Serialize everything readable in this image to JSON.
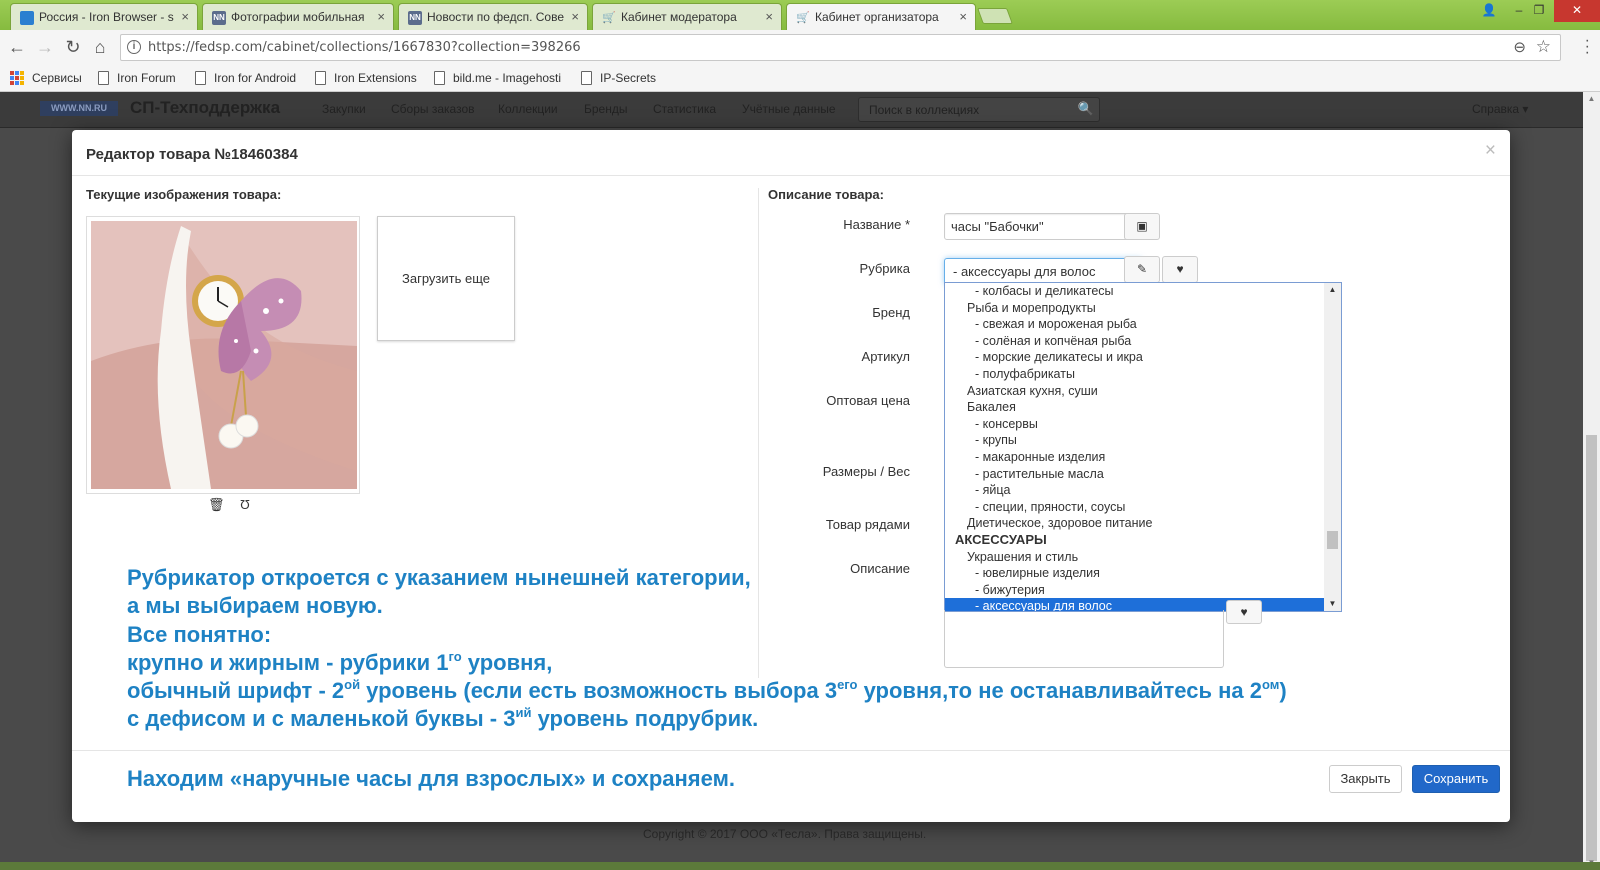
{
  "browser": {
    "tabs": [
      {
        "label": "Россия - Iron Browser - s",
        "icon": "page-blue-icon",
        "color": "#2a7fd0"
      },
      {
        "label": "Фотографии мобильная",
        "icon": "nn-icon",
        "color": "#5b6c8c"
      },
      {
        "label": "Новости по федсп. Сове",
        "icon": "nn-icon",
        "color": "#5b6c8c"
      },
      {
        "label": "Кабинет модератора",
        "icon": "cart-icon",
        "color": "#555555"
      },
      {
        "label": "Кабинет организатора",
        "icon": "cart-icon",
        "color": "#555555"
      }
    ],
    "url": "https://fedsp.com/cabinet/collections/1667830?collection=398266",
    "bookmarks": [
      "Сервисы",
      "Iron Forum",
      "Iron for Android",
      "Iron Extensions",
      "bild.me - Imagehosti",
      "IP-Secrets"
    ]
  },
  "site": {
    "logo": "WWW.NN.RU",
    "brand": "СП-Техподдержка",
    "nav": [
      "Закупки",
      "Сборы заказов",
      "Коллекции",
      "Бренды",
      "Статистика",
      "Учётные данные"
    ],
    "search_placeholder": "Поиск в коллекциях",
    "help": "Справка ▾",
    "footer": "Copyright © 2017 ООО «Тесла». Права защищены."
  },
  "modal": {
    "title": "Редактор товара №18460384",
    "close": "×",
    "images_label": "Текущие изображения товара:",
    "upload_label": "Загрузить еще",
    "delete_icon": "🗑",
    "rotate_icon": "Ʊ",
    "description_label": "Описание товара:",
    "fields": {
      "name": "Название *",
      "rubric": "Рубрика",
      "brand": "Бренд",
      "article": "Артикул",
      "wholesale": "Оптовая цена",
      "size": "Размеры / Вес",
      "rows": "Товар рядами",
      "desc": "Описание"
    },
    "name_value": "часы \"Бабочки\"",
    "rubric_value": "-  аксессуары для волос",
    "rubric_list": [
      {
        "text": "-  колбасы и деликатесы",
        "level": 3
      },
      {
        "text": "Рыба и морепродукты",
        "level": 2
      },
      {
        "text": "-  свежая и мороженая рыба",
        "level": 3
      },
      {
        "text": "-  солёная и копчёная рыба",
        "level": 3
      },
      {
        "text": "-  морские деликатесы и икра",
        "level": 3
      },
      {
        "text": "-  полуфабрикаты",
        "level": 3
      },
      {
        "text": "Азиатская кухня, суши",
        "level": 2
      },
      {
        "text": "Бакалея",
        "level": 2
      },
      {
        "text": "-  консервы",
        "level": 3
      },
      {
        "text": "-  крупы",
        "level": 3
      },
      {
        "text": "-  макаронные изделия",
        "level": 3
      },
      {
        "text": "-  растительные масла",
        "level": 3
      },
      {
        "text": "-  яйца",
        "level": 3
      },
      {
        "text": "-  специи, пряности, соусы",
        "level": 3
      },
      {
        "text": "Диетическое, здоровое питание",
        "level": 2
      },
      {
        "text": "АКСЕССУАРЫ",
        "level": 1
      },
      {
        "text": "Украшения и стиль",
        "level": 2
      },
      {
        "text": "-  ювелирные изделия",
        "level": 3
      },
      {
        "text": "-  бижутерия",
        "level": 3
      },
      {
        "text": "-  аксессуары для волос",
        "level": 3,
        "selected": true
      }
    ],
    "annotation": {
      "line1": "Рубрикатор откроется с указанием нынешней категории,",
      "line2": "а мы выбираем новую.",
      "line3": "Все понятно:",
      "line4a": "крупно и жирным - рубрики 1",
      "line4sup": "го",
      "line4b": " уровня,",
      "line5a": "обычный шрифт - 2",
      "line5sup1": "ой",
      "line5b": " уровень (если есть возможность выбора 3",
      "line5sup2": "его",
      "line5c": " уровня,то не останавливайтесь на 2",
      "line5sup3": "ом",
      "line5d": ")",
      "line6a": "с дефисом и с маленькой буквы - 3",
      "line6sup": "ий",
      "line6b": " уровень подрубрик."
    },
    "footer_note": "Находим «наручные часы для взрослых» и сохраняем.",
    "close_button": "Закрыть",
    "save_button": "Сохранить"
  },
  "colors": {
    "annotation": "#1e82c4",
    "primary": "#2168c9",
    "selected": "#1e6fd9",
    "tabstrip": "#8bc34a"
  }
}
